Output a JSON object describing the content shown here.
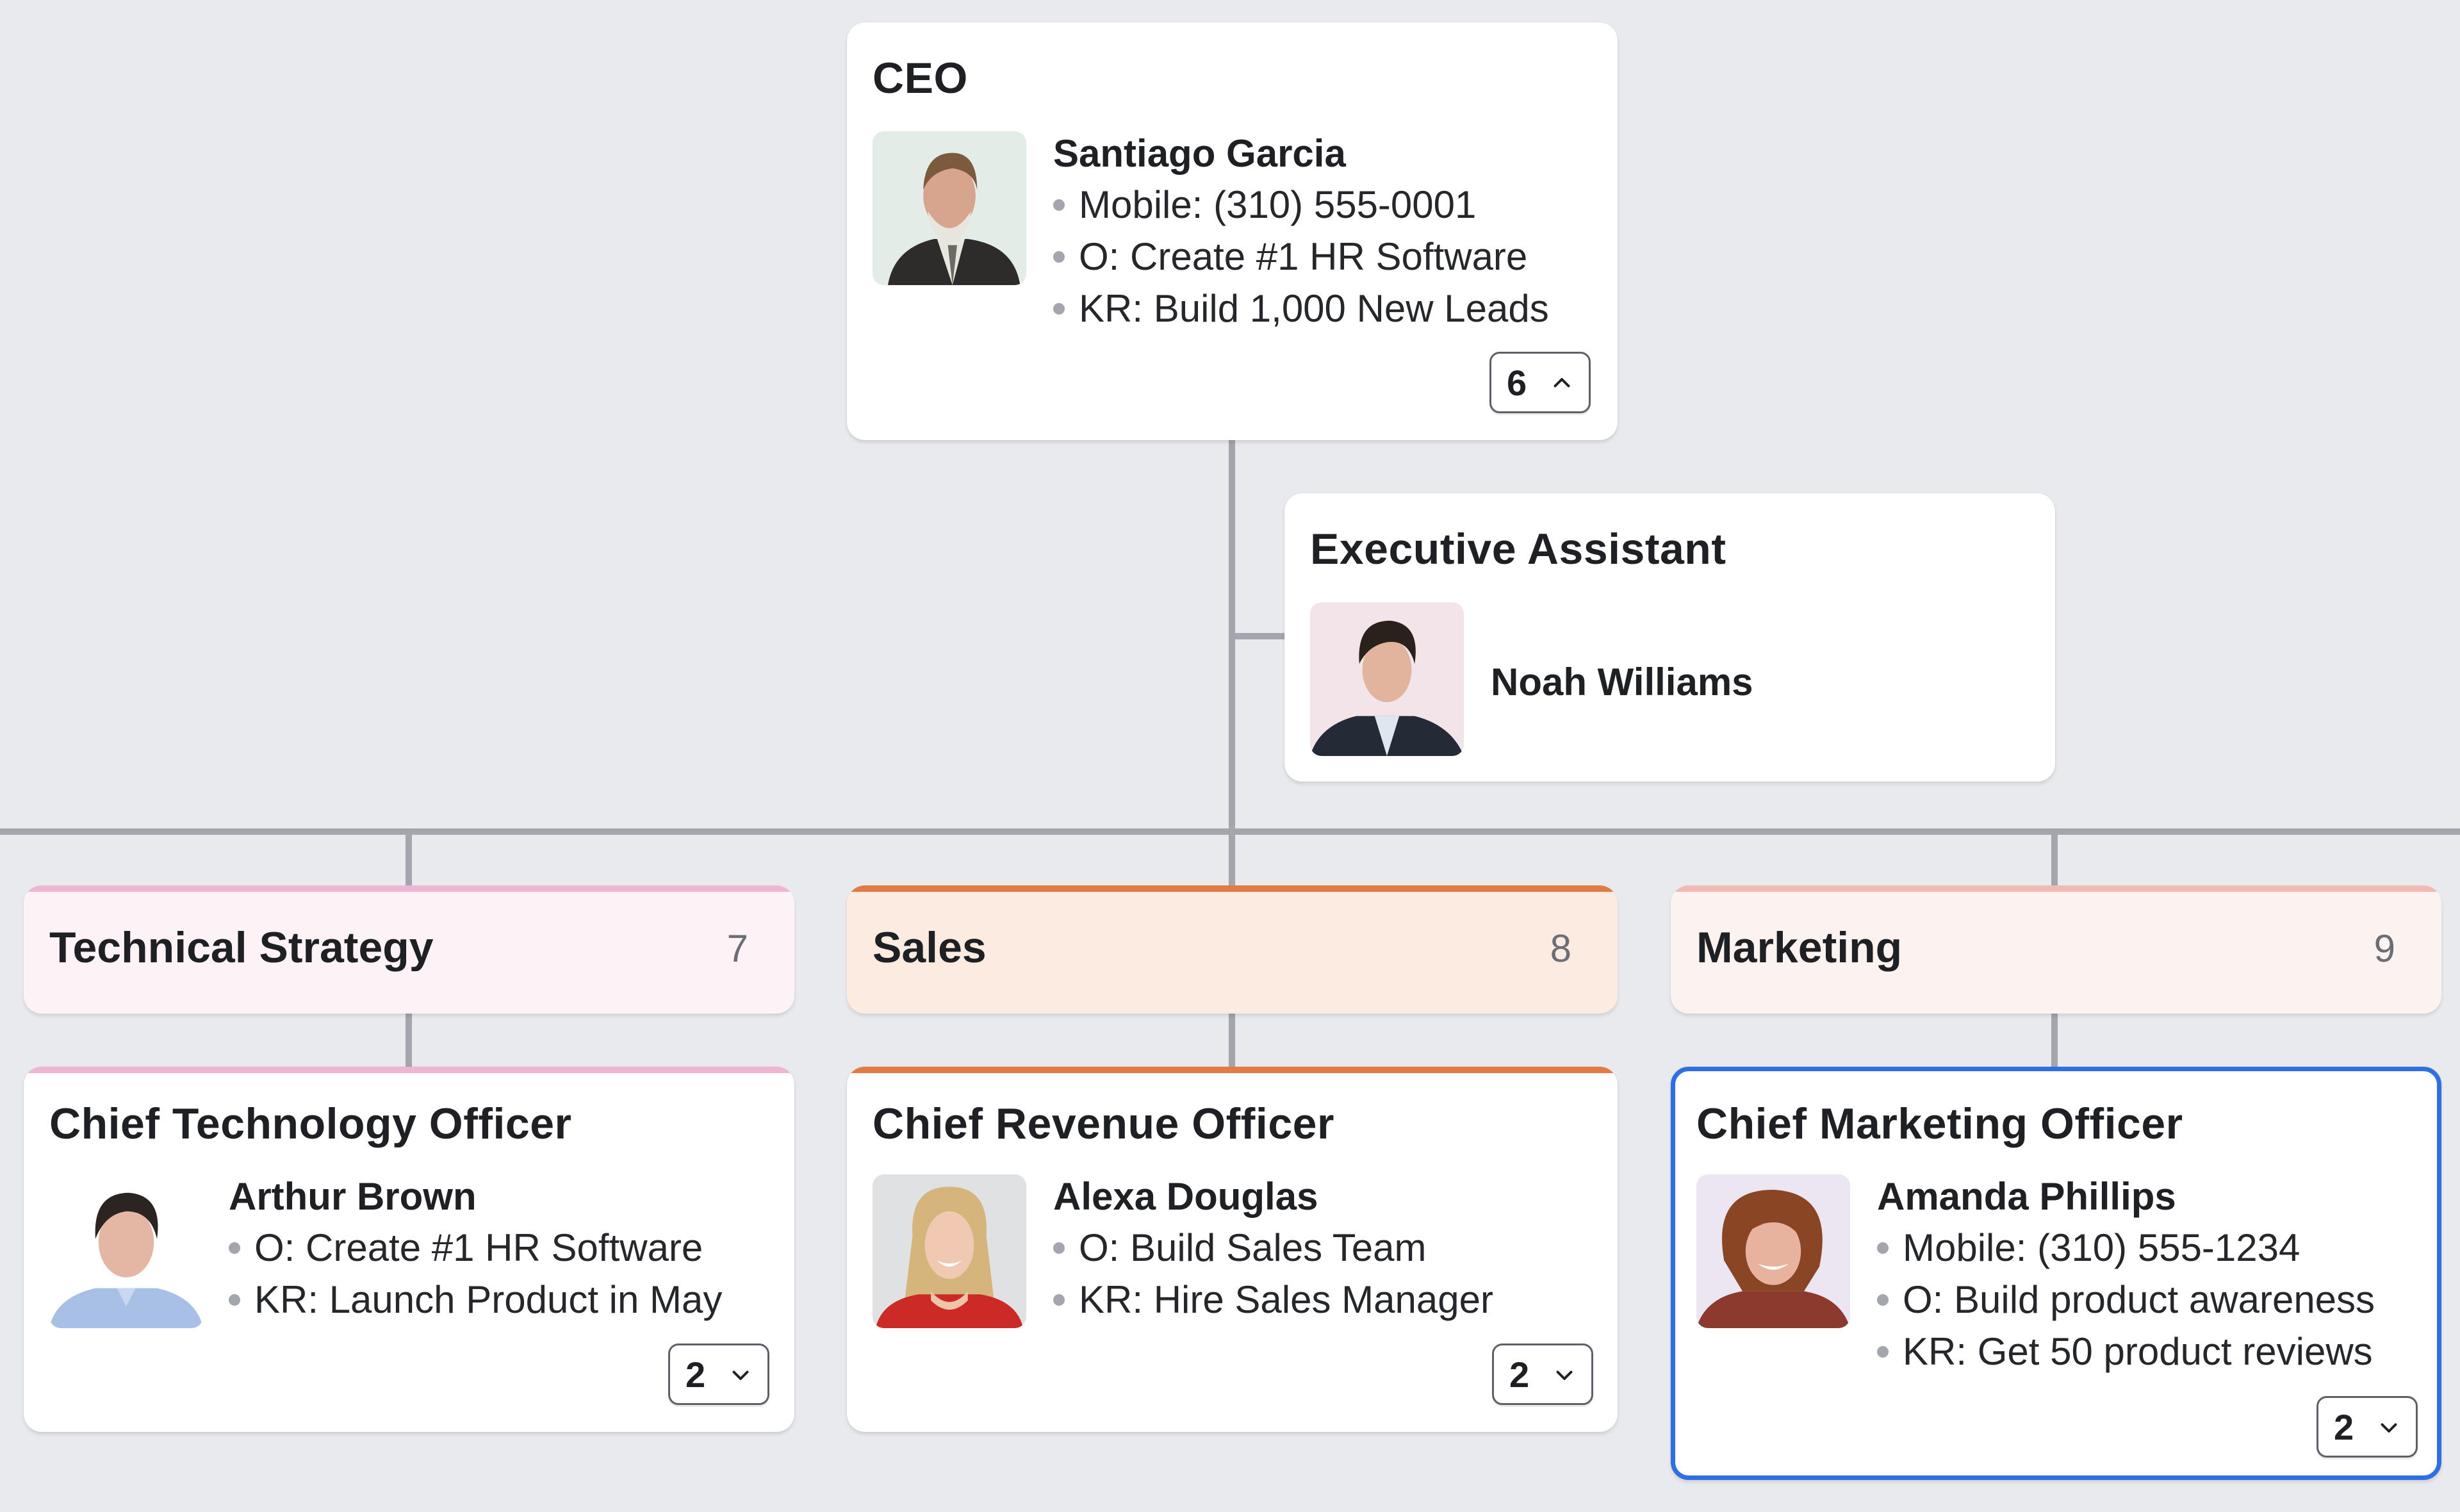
{
  "ceo": {
    "title": "CEO",
    "name": "Santiago Garcia",
    "details": [
      "Mobile: (310) 555-0001",
      "O: Create #1 HR Software",
      "KR: Build 1,000 New Leads"
    ],
    "reports_count": "6",
    "toggle_icon": "chevron-up-icon"
  },
  "assistant": {
    "title": "Executive Assistant",
    "name": "Noah Williams"
  },
  "departments": [
    {
      "label": "Technical Strategy",
      "count": "7",
      "accent": "#efb6d3",
      "bg": "#fdf2f6"
    },
    {
      "label": "Sales",
      "count": "8",
      "accent": "#e27b43",
      "bg": "#fbebe1"
    },
    {
      "label": "Marketing",
      "count": "9",
      "accent": "#f2bab2",
      "bg": "#fcf3f0"
    }
  ],
  "roles": [
    {
      "title": "Chief Technology Officer",
      "name": "Arthur Brown",
      "details": [
        "O: Create #1 HR Software",
        "KR: Launch Product in May"
      ],
      "reports_count": "2",
      "toggle_icon": "chevron-down-icon"
    },
    {
      "title": "Chief Revenue Officer",
      "name": "Alexa Douglas",
      "details": [
        "O: Build Sales Team",
        "KR: Hire Sales Manager"
      ],
      "reports_count": "2",
      "toggle_icon": "chevron-down-icon"
    },
    {
      "title": "Chief Marketing Officer",
      "name": "Amanda Phillips",
      "details": [
        "Mobile: (310) 555-1234",
        "O: Build product awareness",
        "KR: Get 50 product reviews"
      ],
      "reports_count": "2",
      "toggle_icon": "chevron-down-icon",
      "selected": true
    }
  ],
  "colors": {
    "background": "#e9eaee",
    "connector": "#a3a6ad",
    "selection": "#2f6fe4"
  }
}
